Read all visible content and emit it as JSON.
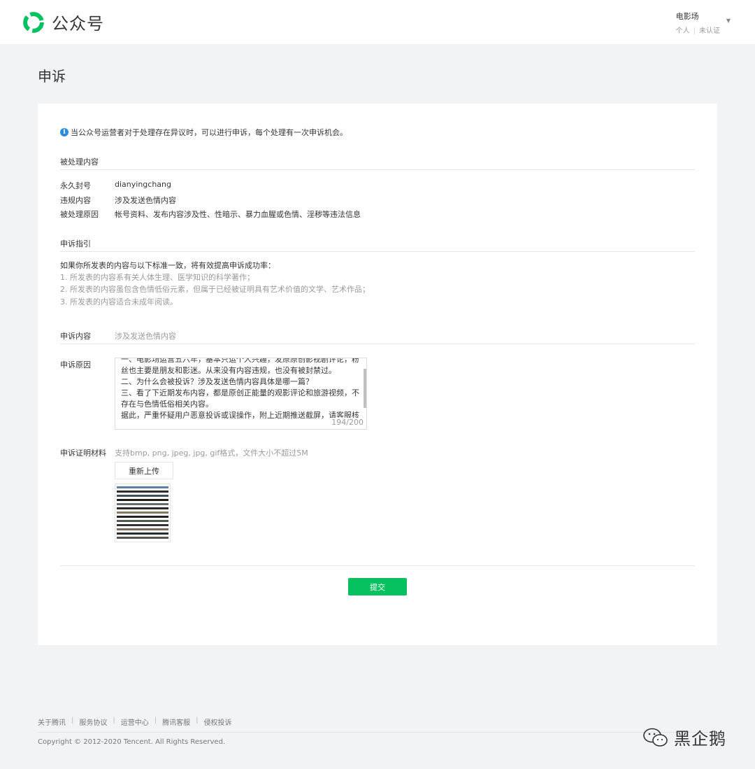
{
  "header": {
    "logo_text": "公众号",
    "account_name": "电影场",
    "account_type": "个人",
    "account_status": "未认证"
  },
  "page": {
    "title": "申诉"
  },
  "notice": "当公众号运营者对于处理存在异议时，可以进行申诉，每个处理有一次申诉机会。",
  "processed": {
    "section_title": "被处理内容",
    "rows": [
      {
        "label": "永久封号",
        "value": "dianyingchang"
      },
      {
        "label": "违规内容",
        "value": "涉及发送色情内容"
      },
      {
        "label": "被处理原因",
        "value": "帐号资料、发布内容涉及性、性暗示、暴力血腥或色情、淫秽等违法信息"
      }
    ]
  },
  "guide": {
    "section_title": "申诉指引",
    "intro": "如果你所发表的内容与以下标准一致，将有效提高申诉成功率：",
    "items": [
      "1. 所发表的内容系有关人体生理、医学知识的科学著作；",
      "2. 所发表的内容虽包含色情低俗元素，但属于已经被证明具有艺术价值的文学、艺术作品；",
      "3. 所发表的内容适合未成年阅读。"
    ]
  },
  "appeal": {
    "content_label": "申诉内容",
    "content_value": "涉及发送色情内容",
    "reason_label": "申诉原因",
    "reason_lines": [
      "一、电影场运营五六年，基本只运个人兴趣，发原原创影视剧评论，粉",
      "丝也主要是朋友和影迷。从来没有内容违规，也没有被封禁过。",
      "二、为什么会被投诉？涉及发送色情内容具体是哪一篇？",
      "三、看了下近期发布内容，都是原创正能量的观影评论和旅游视频，不",
      "存在与色情低俗相关内容。",
      "据此，严重怀疑用户恶意投诉或误操作，附上近期推送截屏，请客服核"
    ],
    "reason_count": "194/200",
    "evidence_label": "申诉证明材料",
    "evidence_hint": "支持bmp, png, jpeg, jpg, gif格式，文件大小不超过5M",
    "reupload_label": "重新上传",
    "submit_label": "提交"
  },
  "footer": {
    "links": [
      "关于腾讯",
      "服务协议",
      "运营中心",
      "腾讯客服",
      "侵权投诉"
    ],
    "copyright": "Copyright © 2012-2020 Tencent. All Rights Reserved."
  },
  "watermark": {
    "text": "黑企鹅",
    "icon": "wechat-icon"
  },
  "colors": {
    "brand_green": "#07c160",
    "info_blue": "#2e8bde",
    "page_bg": "#f2f3f5"
  }
}
